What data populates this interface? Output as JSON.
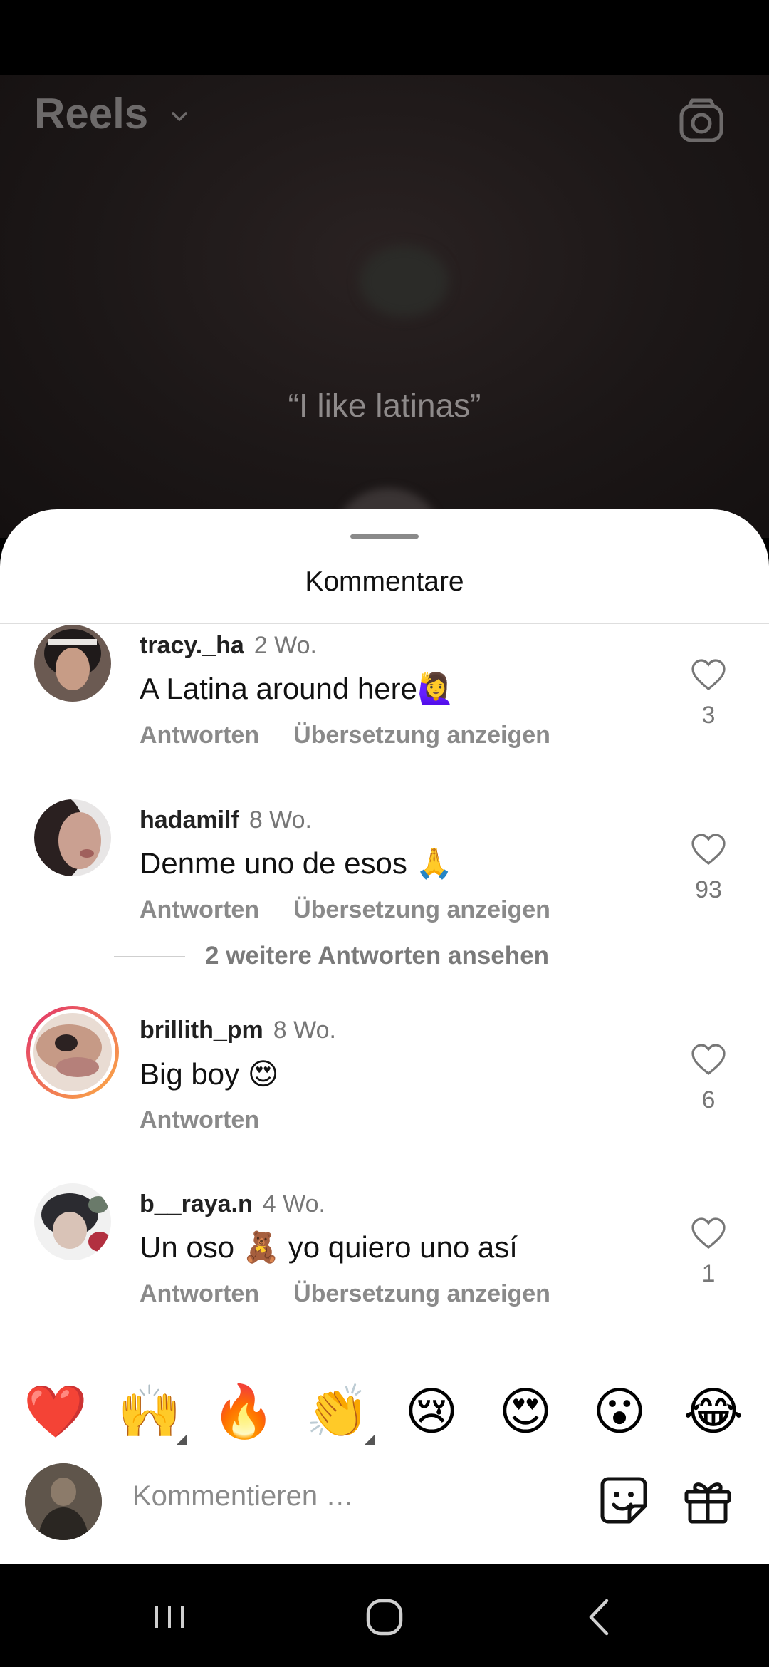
{
  "header": {
    "title": "Reels"
  },
  "video": {
    "caption": "“I like latinas”"
  },
  "sheet": {
    "title": "Kommentare"
  },
  "comments": [
    {
      "username": "tracy._ha",
      "time": "2 Wo.",
      "text": "A Latina around here🙋‍♀️",
      "reply": "Antworten",
      "translate": "Übersetzung anzeigen",
      "likes": "3"
    },
    {
      "username": "hadamilf",
      "time": "8 Wo.",
      "text": "Denme uno de esos 🙏",
      "reply": "Antworten",
      "translate": "Übersetzung anzeigen",
      "likes": "93"
    },
    {
      "username": "brillith_pm",
      "time": "8 Wo.",
      "text": "Big boy 😍",
      "reply": "Antworten",
      "likes": "6"
    },
    {
      "username": "b__raya.n",
      "time": "4 Wo.",
      "text": "Un oso 🧸 yo quiero uno así",
      "reply": "Antworten",
      "translate": "Übersetzung anzeigen",
      "likes": "1"
    }
  ],
  "more_replies": "2 weitere Antworten ansehen",
  "emoji_bar": [
    "❤️",
    "🙌",
    "🔥",
    "👏",
    "😢",
    "😍",
    "😮",
    "😂"
  ],
  "composer": {
    "placeholder": "Kommentieren …"
  },
  "icons": {
    "header": [
      "chevron-down-icon",
      "camera-icon"
    ],
    "comment": [
      "heart-icon"
    ],
    "composer": [
      "sticker-icon",
      "gift-icon"
    ],
    "nav": [
      "recents-icon",
      "home-icon",
      "back-icon"
    ]
  },
  "colors": {
    "sheet_bg": "#ffffff",
    "story_ring_start": "#e1306c",
    "story_ring_end": "#fcaf45"
  }
}
